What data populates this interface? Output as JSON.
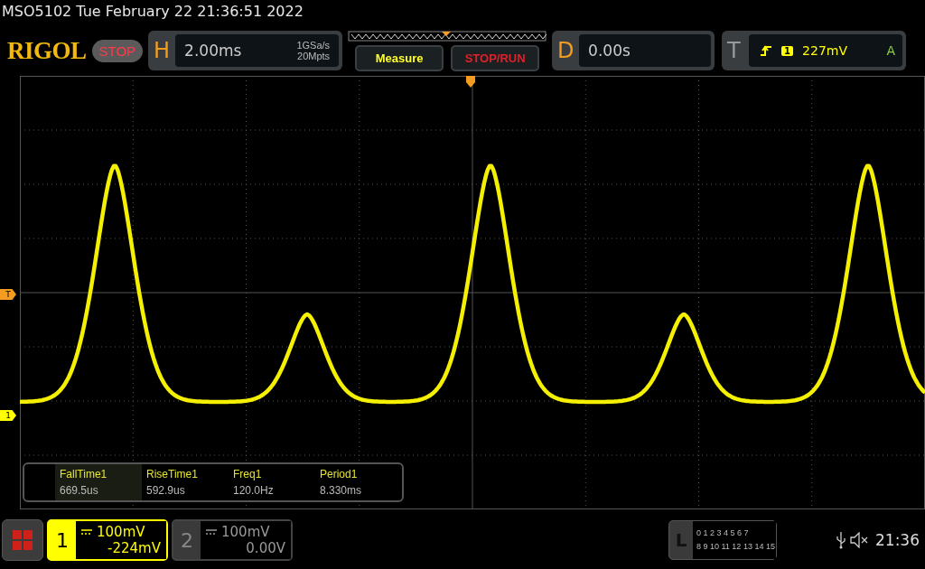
{
  "status_line": "MSO5102  Tue February 22 21:36:51 2022",
  "toolbar": {
    "logo": "RIGOL",
    "run_state": "STOP",
    "horizontal": {
      "letter": "H",
      "timebase": "2.00ms",
      "sample_rate": "1GSa/s",
      "memory_depth": "20Mpts"
    },
    "buttons": [
      "Measure",
      "STOP/RUN"
    ],
    "delay": {
      "letter": "D",
      "value": "0.00s"
    },
    "trigger": {
      "letter": "T",
      "source": "1",
      "level": "227mV",
      "mode": "A"
    }
  },
  "screen": {
    "trigger_marker": "T",
    "channel_markers": [
      {
        "label": "1",
        "color": "#ffff00"
      }
    ]
  },
  "measurements": [
    {
      "name": "FallTime1",
      "value": "669.5us",
      "selected": true
    },
    {
      "name": "RiseTime1",
      "value": "592.9us",
      "selected": false
    },
    {
      "name": "Freq1",
      "value": "120.0Hz",
      "selected": false
    },
    {
      "name": "Period1",
      "value": "8.330ms",
      "selected": false
    }
  ],
  "channels": [
    {
      "number": "1",
      "scale": "100mV",
      "offset": "-224mV",
      "selected": true
    },
    {
      "number": "2",
      "scale": "100mV",
      "offset": "0.00V",
      "selected": false
    }
  ],
  "logic": {
    "letter": "L",
    "row_1": "0 1 2 3  4 5 6 7",
    "row_2": "8 9 10 11 12 13 14 15"
  },
  "clock": "21:36"
}
